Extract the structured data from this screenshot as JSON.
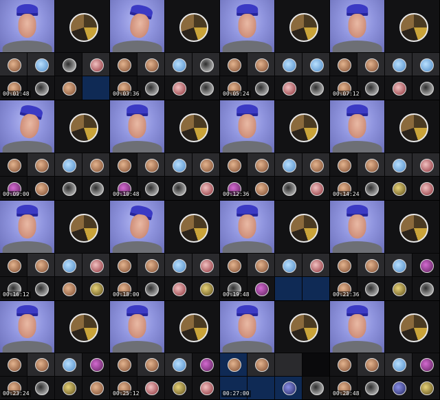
{
  "timestamps": [
    "00:01:48",
    "00:03:36",
    "00:05:24",
    "00:07:12",
    "00:09:00",
    "00:10:48",
    "00:12:36",
    "00:14:24",
    "00:16:12",
    "00:18:00",
    "00:19:48",
    "00:21:36",
    "00:23:24",
    "00:25:12",
    "00:27:00",
    "00:28:48"
  ]
}
